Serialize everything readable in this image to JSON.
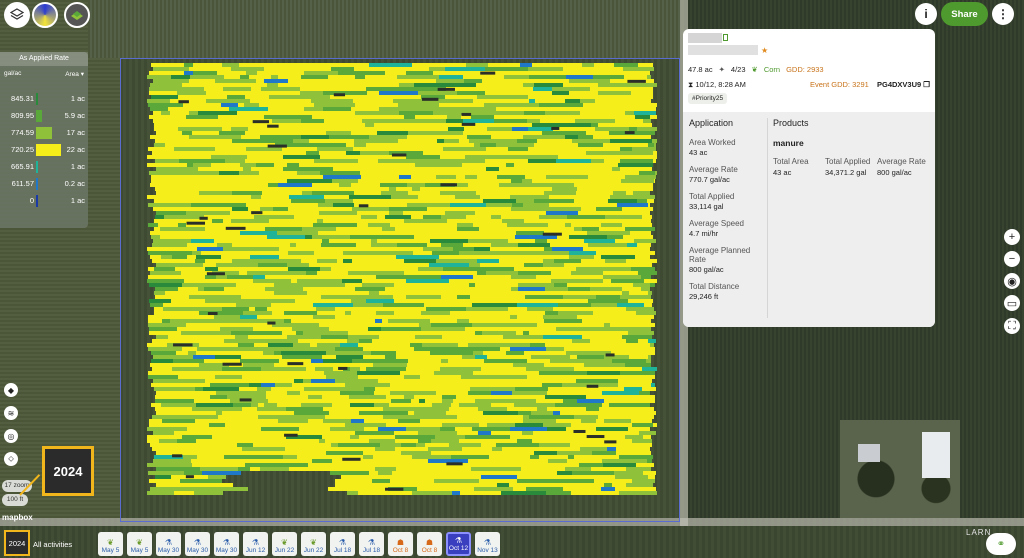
{
  "year_callout": "2024",
  "legend": {
    "title": "As Applied Rate",
    "unit_label": "gal/ac",
    "area_label": "Area ▾",
    "rows": [
      {
        "value": "845.31",
        "area": "1 ac",
        "fraction": 0.05,
        "color": "#2a8a3c"
      },
      {
        "value": "809.95",
        "area": "5.9 ac",
        "fraction": 0.22,
        "color": "#5aa73a"
      },
      {
        "value": "774.59",
        "area": "17 ac",
        "fraction": 0.62,
        "color": "#8fc23a"
      },
      {
        "value": "720.25",
        "area": "22 ac",
        "fraction": 0.95,
        "color": "#f5ee1a"
      },
      {
        "value": "665.91",
        "area": "1 ac",
        "fraction": 0.05,
        "color": "#1fb39a"
      },
      {
        "value": "611.57",
        "area": "0.2 ac",
        "fraction": 0.03,
        "color": "#1f78c8"
      },
      {
        "value": "0",
        "area": "1 ac",
        "fraction": 0.04,
        "color": "#1a3aa8"
      }
    ]
  },
  "map": {
    "zoom_label": "17 zoom",
    "scale_label": "100 ft",
    "attribution": "mapbox",
    "road_label": "LARN"
  },
  "toolbar": {
    "share_label": "Share",
    "info_icon": "info-icon",
    "more_icon": "more-vertical-icon"
  },
  "panel": {
    "area": "47.8 ac",
    "plant_date": "4/23",
    "crop": "Corn",
    "gdd": "GDD: 2933",
    "timestamp": "10/12, 8:28 AM",
    "event_gdd": "Event GDD: 3291",
    "code": "PG4DXV3U9",
    "tag": "#Priority25",
    "application": {
      "title": "Application",
      "stats": [
        {
          "label": "Area Worked",
          "value": "43 ac"
        },
        {
          "label": "Average Rate",
          "value": "770.7 gal/ac"
        },
        {
          "label": "Total Applied",
          "value": "33,114 gal"
        },
        {
          "label": "Average Speed",
          "value": "4.7 mi/hr"
        },
        {
          "label": "Average Planned Rate",
          "value": "800 gal/ac"
        },
        {
          "label": "Total Distance",
          "value": "29,246 ft"
        }
      ]
    },
    "products": {
      "title": "Products",
      "name": "manure",
      "columns": [
        {
          "label": "Total Area",
          "value": "43 ac"
        },
        {
          "label": "Total Applied",
          "value": "34,371.2 gal"
        },
        {
          "label": "Average Rate",
          "value": "800 gal/ac"
        }
      ]
    }
  },
  "timeline": {
    "year": "2024",
    "all_label": "All activities",
    "chips": [
      {
        "label": "May 5",
        "kind": "green"
      },
      {
        "label": "May 5",
        "kind": "green"
      },
      {
        "label": "May 30",
        "kind": "blue"
      },
      {
        "label": "May 30",
        "kind": "blue"
      },
      {
        "label": "May 30",
        "kind": "blue"
      },
      {
        "label": "Jun 12",
        "kind": "blue"
      },
      {
        "label": "Jun 22",
        "kind": "green"
      },
      {
        "label": "Jun 22",
        "kind": "green"
      },
      {
        "label": "Jul 18",
        "kind": "blue"
      },
      {
        "label": "Jul 18",
        "kind": "blue"
      },
      {
        "label": "Oct 8",
        "kind": "orange"
      },
      {
        "label": "Oct 8",
        "kind": "orange"
      },
      {
        "label": "Oct 12",
        "kind": "selected"
      },
      {
        "label": "Nov 13",
        "kind": "blue"
      }
    ]
  }
}
